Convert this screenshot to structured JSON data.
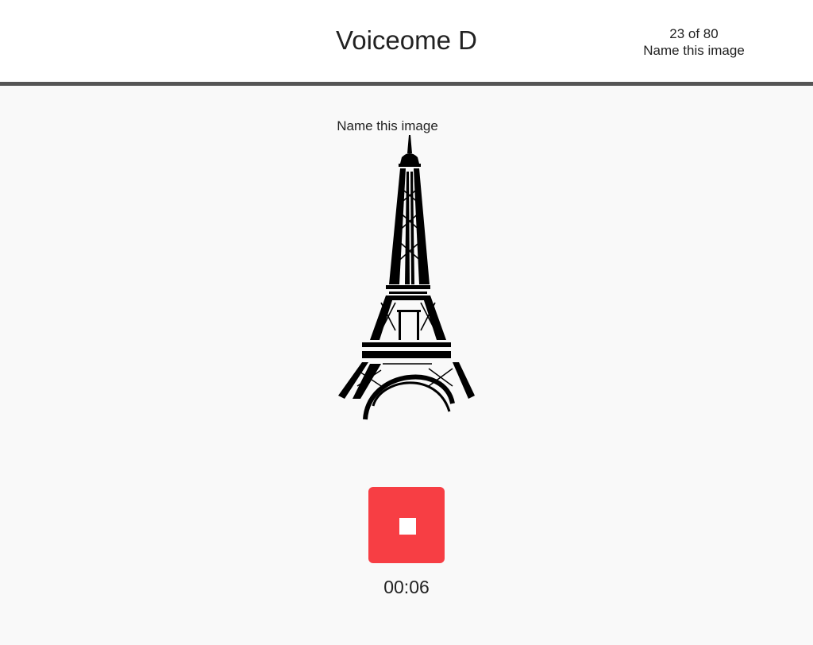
{
  "header": {
    "title": "Voiceome D",
    "progress": "23 of 80",
    "task_name": "Name this image"
  },
  "task": {
    "prompt": "Name this image",
    "image_subject": "eiffel-tower"
  },
  "recorder": {
    "button_icon": "stop-icon",
    "button_color": "#f73e44",
    "elapsed": "00:06"
  }
}
